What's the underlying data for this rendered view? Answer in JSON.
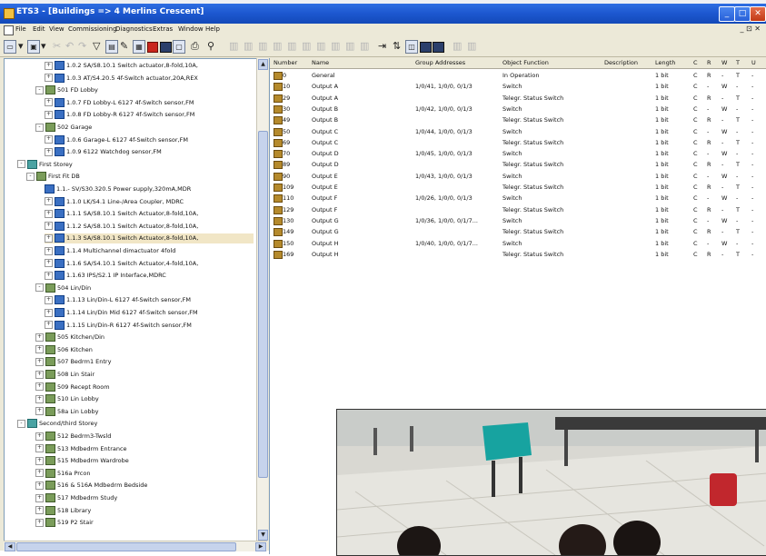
{
  "window": {
    "title": "ETS3 - [Buildings => 4 Merlins Crescent]",
    "min": "_",
    "max": "□",
    "close": "✕"
  },
  "menu": {
    "items": [
      "File",
      "Edit",
      "View",
      "Commissioning",
      "Diagnostics",
      "Extras",
      "Window",
      "Help"
    ],
    "mdi_controls": "_ ⊡ ✕"
  },
  "tree": [
    {
      "depth": 4,
      "exp": "+",
      "icon": "dev",
      "text": "1.0.2 SA/S8.10.1 Switch actuator,8-fold,10A,",
      "sel": false
    },
    {
      "depth": 4,
      "exp": "+",
      "icon": "dev",
      "text": "1.0.3 AT/S4.20.5 4f-Switch actuator,20A,REX",
      "sel": false
    },
    {
      "depth": 3,
      "exp": "-",
      "icon": "room",
      "text": "501 FD Lobby",
      "sel": false
    },
    {
      "depth": 4,
      "exp": "+",
      "icon": "dev",
      "text": "1.0.7 FD Lobby-L 6127 4f-Switch sensor,FM",
      "sel": false
    },
    {
      "depth": 4,
      "exp": "+",
      "icon": "dev",
      "text": "1.0.8 FD Lobby-R 6127 4f-Switch sensor,FM",
      "sel": false
    },
    {
      "depth": 3,
      "exp": "-",
      "icon": "room",
      "text": "502 Garage",
      "sel": false
    },
    {
      "depth": 4,
      "exp": "+",
      "icon": "dev",
      "text": "1.0.6 Garage-L 6127 4f-Switch sensor,FM",
      "sel": false
    },
    {
      "depth": 4,
      "exp": "+",
      "icon": "dev",
      "text": "1.0.9 6122 Watchdog sensor,FM",
      "sel": false
    },
    {
      "depth": 1,
      "exp": "-",
      "icon": "floor",
      "text": "First Storey",
      "sel": false
    },
    {
      "depth": 2,
      "exp": "-",
      "icon": "room",
      "text": "First Fit DB",
      "sel": false
    },
    {
      "depth": 4,
      "exp": "",
      "icon": "dev",
      "text": "1.1.- SV/S30.320.5 Power supply,320mA,MDR",
      "sel": false
    },
    {
      "depth": 4,
      "exp": "+",
      "icon": "dev",
      "text": "1.1.0 LK/S4.1 Line-/Area Coupler, MDRC",
      "sel": false
    },
    {
      "depth": 4,
      "exp": "+",
      "icon": "dev",
      "text": "1.1.1 SA/S8.10.1 Switch Actuator,8-fold,10A,",
      "sel": false
    },
    {
      "depth": 4,
      "exp": "+",
      "icon": "dev",
      "text": "1.1.2 SA/S8.10.1 Switch Actuator,8-fold,10A,",
      "sel": false
    },
    {
      "depth": 4,
      "exp": "+",
      "icon": "dev",
      "text": "1.1.3 SA/S8.10.1 Switch Actuator,8-fold,10A,",
      "sel": true
    },
    {
      "depth": 4,
      "exp": "+",
      "icon": "dev",
      "text": "1.1.4 Multichannel dimactuator 4fold",
      "sel": false
    },
    {
      "depth": 4,
      "exp": "+",
      "icon": "dev",
      "text": "1.1.6 SA/S4.10.1 Switch Actuator,4-fold,10A,",
      "sel": false
    },
    {
      "depth": 4,
      "exp": "+",
      "icon": "dev",
      "text": "1.1.63 IPS/S2.1 IP Interface,MDRC",
      "sel": false
    },
    {
      "depth": 3,
      "exp": "-",
      "icon": "room",
      "text": "504 Lin/Din",
      "sel": false
    },
    {
      "depth": 4,
      "exp": "+",
      "icon": "dev",
      "text": "1.1.13 Lin/Din-L 6127 4f-Switch sensor,FM",
      "sel": false
    },
    {
      "depth": 4,
      "exp": "+",
      "icon": "dev",
      "text": "1.1.14 Lin/Din Mid 6127 4f-Switch sensor,FM",
      "sel": false
    },
    {
      "depth": 4,
      "exp": "+",
      "icon": "dev",
      "text": "1.1.15 Lin/Din-R 6127 4f-Switch sensor,FM",
      "sel": false
    },
    {
      "depth": 3,
      "exp": "+",
      "icon": "room",
      "text": "505 Kitchen/Din",
      "sel": false
    },
    {
      "depth": 3,
      "exp": "+",
      "icon": "room",
      "text": "506 Kitchen",
      "sel": false
    },
    {
      "depth": 3,
      "exp": "+",
      "icon": "room",
      "text": "507 Bedrm1 Entry",
      "sel": false
    },
    {
      "depth": 3,
      "exp": "+",
      "icon": "room",
      "text": "508 Lin Stair",
      "sel": false
    },
    {
      "depth": 3,
      "exp": "+",
      "icon": "room",
      "text": "509 Recept Room",
      "sel": false
    },
    {
      "depth": 3,
      "exp": "+",
      "icon": "room",
      "text": "510 Lin Lobby",
      "sel": false
    },
    {
      "depth": 3,
      "exp": "+",
      "icon": "room",
      "text": "58a Lin Lobby",
      "sel": false
    },
    {
      "depth": 1,
      "exp": "-",
      "icon": "floor",
      "text": "Second/third Storey",
      "sel": false
    },
    {
      "depth": 3,
      "exp": "+",
      "icon": "room",
      "text": "512 Bedrm3-Twsld",
      "sel": false
    },
    {
      "depth": 3,
      "exp": "+",
      "icon": "room",
      "text": "513 Mdbedrm Entrance",
      "sel": false
    },
    {
      "depth": 3,
      "exp": "+",
      "icon": "room",
      "text": "515 Mdbedrm Wardrobe",
      "sel": false
    },
    {
      "depth": 3,
      "exp": "+",
      "icon": "room",
      "text": "516a Prcon",
      "sel": false
    },
    {
      "depth": 3,
      "exp": "+",
      "icon": "room",
      "text": "516 & 516A Mdbedrm Bedside",
      "sel": false
    },
    {
      "depth": 3,
      "exp": "+",
      "icon": "room",
      "text": "517 Mdbedrm Study",
      "sel": false
    },
    {
      "depth": 3,
      "exp": "+",
      "icon": "room",
      "text": "518 Library",
      "sel": false
    },
    {
      "depth": 3,
      "exp": "+",
      "icon": "room",
      "text": "519 P2 Stair",
      "sel": false
    }
  ],
  "grid": {
    "headers": [
      "Number",
      "Name",
      "Group Addresses",
      "Object Function",
      "Description",
      "Length",
      "C",
      "R",
      "W",
      "T",
      "U"
    ],
    "rows": [
      {
        "num": "0",
        "name": "General",
        "ga": "",
        "func": "In Operation",
        "len": "1 bit",
        "c": "C",
        "r": "R",
        "w": "-",
        "t": "T",
        "u": "-"
      },
      {
        "num": "10",
        "name": "Output A",
        "ga": "1/0/41, 1/0/0, 0/1/3",
        "func": "Switch",
        "len": "1 bit",
        "c": "C",
        "r": "-",
        "w": "W",
        "t": "-",
        "u": "-"
      },
      {
        "num": "29",
        "name": "Output A",
        "ga": "",
        "func": "Telegr. Status Switch",
        "len": "1 bit",
        "c": "C",
        "r": "R",
        "w": "-",
        "t": "T",
        "u": "-"
      },
      {
        "num": "30",
        "name": "Output B",
        "ga": "1/0/42, 1/0/0, 0/1/3",
        "func": "Switch",
        "len": "1 bit",
        "c": "C",
        "r": "-",
        "w": "W",
        "t": "-",
        "u": "-"
      },
      {
        "num": "49",
        "name": "Output B",
        "ga": "",
        "func": "Telegr. Status Switch",
        "len": "1 bit",
        "c": "C",
        "r": "R",
        "w": "-",
        "t": "T",
        "u": "-"
      },
      {
        "num": "50",
        "name": "Output C",
        "ga": "1/0/44, 1/0/0, 0/1/3",
        "func": "Switch",
        "len": "1 bit",
        "c": "C",
        "r": "-",
        "w": "W",
        "t": "-",
        "u": "-"
      },
      {
        "num": "69",
        "name": "Output C",
        "ga": "",
        "func": "Telegr. Status Switch",
        "len": "1 bit",
        "c": "C",
        "r": "R",
        "w": "-",
        "t": "T",
        "u": "-"
      },
      {
        "num": "70",
        "name": "Output D",
        "ga": "1/0/45, 1/0/0, 0/1/3",
        "func": "Switch",
        "len": "1 bit",
        "c": "C",
        "r": "-",
        "w": "W",
        "t": "-",
        "u": "-"
      },
      {
        "num": "89",
        "name": "Output D",
        "ga": "",
        "func": "Telegr. Status Switch",
        "len": "1 bit",
        "c": "C",
        "r": "R",
        "w": "-",
        "t": "T",
        "u": "-"
      },
      {
        "num": "90",
        "name": "Output E",
        "ga": "1/0/43, 1/0/0, 0/1/3",
        "func": "Switch",
        "len": "1 bit",
        "c": "C",
        "r": "-",
        "w": "W",
        "t": "-",
        "u": "-"
      },
      {
        "num": "109",
        "name": "Output E",
        "ga": "",
        "func": "Telegr. Status Switch",
        "len": "1 bit",
        "c": "C",
        "r": "R",
        "w": "-",
        "t": "T",
        "u": "-"
      },
      {
        "num": "110",
        "name": "Output F",
        "ga": "1/0/26, 1/0/0, 0/1/3",
        "func": "Switch",
        "len": "1 bit",
        "c": "C",
        "r": "-",
        "w": "W",
        "t": "-",
        "u": "-"
      },
      {
        "num": "129",
        "name": "Output F",
        "ga": "",
        "func": "Telegr. Status Switch",
        "len": "1 bit",
        "c": "C",
        "r": "R",
        "w": "-",
        "t": "T",
        "u": "-"
      },
      {
        "num": "130",
        "name": "Output G",
        "ga": "1/0/36, 1/0/0, 0/1/7...",
        "func": "Switch",
        "len": "1 bit",
        "c": "C",
        "r": "-",
        "w": "W",
        "t": "-",
        "u": "-"
      },
      {
        "num": "149",
        "name": "Output G",
        "ga": "",
        "func": "Telegr. Status Switch",
        "len": "1 bit",
        "c": "C",
        "r": "R",
        "w": "-",
        "t": "T",
        "u": "-"
      },
      {
        "num": "150",
        "name": "Output H",
        "ga": "1/0/40, 1/0/0, 0/1/7...",
        "func": "Switch",
        "len": "1 bit",
        "c": "C",
        "r": "-",
        "w": "W",
        "t": "-",
        "u": "-"
      },
      {
        "num": "169",
        "name": "Output H",
        "ga": "",
        "func": "Telegr. Status Switch",
        "len": "1 bit",
        "c": "C",
        "r": "R",
        "w": "-",
        "t": "T",
        "u": "-"
      }
    ]
  },
  "colors": {
    "titlebar": "#1c57cf",
    "selection": "#f1e6c6",
    "photo_chair": "#17a3a0"
  }
}
